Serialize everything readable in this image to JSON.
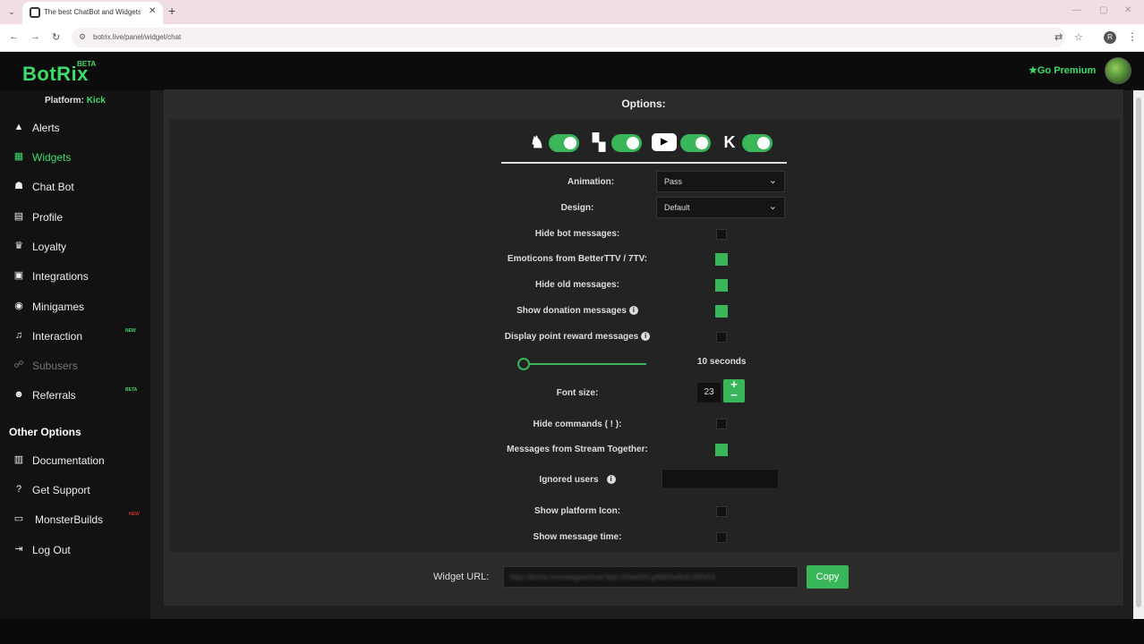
{
  "browser": {
    "tab_title": "The best ChatBot and Widgets",
    "url": "botrix.live/panel/widget/chat",
    "tab_close": "✕",
    "new_tab": "+"
  },
  "app": {
    "logo": "BotRix",
    "logo_badge": "BETA",
    "premium_label": "★Go Premium"
  },
  "sidebar": {
    "platform_label": "Platform:",
    "platform_value": "Kick",
    "items": [
      {
        "label": "Alerts",
        "icon": "alert-icon"
      },
      {
        "label": "Widgets",
        "icon": "widgets-icon",
        "active": true
      },
      {
        "label": "Chat Bot",
        "icon": "robot-icon"
      },
      {
        "label": "Profile",
        "icon": "profile-card-icon"
      },
      {
        "label": "Loyalty",
        "icon": "trophy-icon"
      },
      {
        "label": "Integrations",
        "icon": "integrations-icon"
      },
      {
        "label": "Minigames",
        "icon": "gamepad-icon"
      },
      {
        "label": "Interaction",
        "icon": "music-icon",
        "badge": "NEW"
      },
      {
        "label": "Subusers",
        "icon": "subusers-icon",
        "disabled": true
      },
      {
        "label": "Referrals",
        "icon": "users-icon",
        "badge": "BETA"
      }
    ],
    "other_header": "Other Options",
    "other_items": [
      {
        "label": "Documentation",
        "icon": "book-icon"
      },
      {
        "label": "Get Support",
        "icon": "help-icon"
      },
      {
        "label": "MonsterBuilds",
        "icon": "laptop-icon",
        "badge": "NEW"
      },
      {
        "label": "Log Out",
        "icon": "logout-icon"
      }
    ]
  },
  "main": {
    "title": "Options:",
    "platforms": [
      {
        "name": "Trovo",
        "enabled": true
      },
      {
        "name": "Twitch",
        "enabled": true
      },
      {
        "name": "YouTube",
        "enabled": true
      },
      {
        "name": "Kick",
        "enabled": true
      }
    ],
    "animation_label": "Animation:",
    "animation_value": "Pass",
    "design_label": "Design:",
    "design_value": "Default",
    "hide_bot_label": "Hide bot messages:",
    "emoticons_label": "Emoticons from BetterTTV / 7TV:",
    "hide_old_label": "Hide old messages:",
    "show_donation_label": "Show donation messages",
    "display_point_label": "Display point reward messages",
    "slider_value": "10 seconds",
    "slider_fraction": 0.05,
    "font_size_label": "Font size:",
    "font_size_value": "23",
    "hide_commands_label": "Hide commands ( ! ):",
    "stream_together_label": "Messages from Stream Together:",
    "ignored_users_label": "Ignored users",
    "show_platform_icon_label": "Show platform Icon:",
    "show_message_time_label": "Show message time:",
    "checkboxes": {
      "hide_bot": false,
      "emoticons": true,
      "hide_old": true,
      "show_donation": true,
      "display_point": false,
      "hide_commands": false,
      "stream_together": true,
      "show_platform_icon": false,
      "show_message_time": false
    },
    "widget_url_label": "Widget URL:",
    "widget_url_value": "https://botrix.live/widgets/chat?bid=3rf4aG6Cg8Nh5wRd2J9Pk5X",
    "copy_label": "Copy"
  },
  "colors": {
    "accent": "#3ab65a",
    "logo_green": "#3ddc6a",
    "sidebar_bg": "#121212",
    "panel_bg": "#2b2b2b"
  }
}
